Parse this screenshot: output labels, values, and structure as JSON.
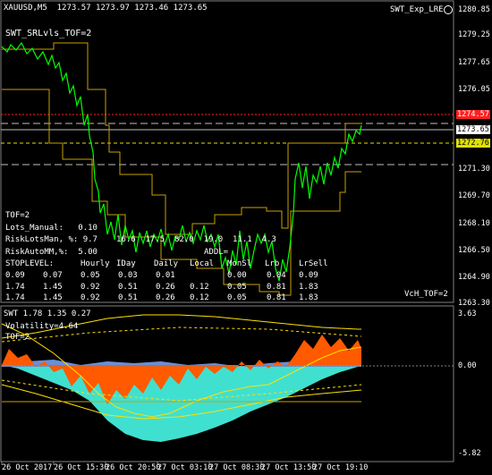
{
  "header": {
    "symbol_info": "XAUUSD,M5  1273.57 1273.97 1273.46 1273.65",
    "indicator_name": "SWT_SRLvls_TOF=2",
    "expert_name": "SWT_Exp_LRE"
  },
  "price_axis": {
    "labels": [
      "1280.85",
      "1279.25",
      "1277.65",
      "1276.05",
      "1274.57",
      "1273.65",
      "1272.76",
      "1271.30",
      "1269.70",
      "1268.10",
      "1266.50",
      "1264.90",
      "1263.30"
    ],
    "bid_tag": {
      "text": "1274.57",
      "color": "#ff3030"
    },
    "current_tag": {
      "text": "1273.65",
      "color": "#ffffff"
    },
    "level_tag": {
      "text": "1272.76",
      "color": "#e0e000"
    }
  },
  "info_panel": {
    "line_tof": "TOF=2",
    "line_lots": "Lots_Manual:   0.10",
    "line_risk_lots": "RiskLotsMan, %: 9.7",
    "line_risk_auto": "RiskAutoMM,%:  5.00",
    "line_stoplevel": "STOPLEVEL:",
    "col_headers": [
      "Hourly",
      "IDay",
      "Daily",
      "Local",
      "MonSl",
      "Lrb",
      "LrSell"
    ],
    "rows": [
      [
        "0.09",
        "0.07",
        "0.05",
        "0.03",
        "0.01",
        "0.00",
        "0.04",
        "0.09"
      ],
      [
        "1.74",
        "1.45",
        "0.92",
        "0.51",
        "0.26",
        "0.12",
        "0.05",
        "0.81",
        "1.83"
      ],
      [
        "1.74",
        "1.45",
        "0.92",
        "0.51",
        "0.26",
        "0.12",
        "0.05",
        "0.81",
        "1.83"
      ]
    ],
    "overlay_row": "16.6  17.5  82.0  19.0  11.1  4.3",
    "overlay_row2": "ADDL="
  },
  "vch_label": "VcH_TOF=2",
  "osc": {
    "title": "SWT 1.78 1.35 0.27",
    "volatility": "Volatility=4.64",
    "tof": "TOF=2",
    "axis_labels": [
      "3.63",
      "0.00",
      "-5.82"
    ]
  },
  "time_axis": {
    "labels": [
      "26 Oct 2017",
      "26 Oct 15:30",
      "26 Oct 20:50",
      "27 Oct 03:10",
      "27 Oct 08:30",
      "27 Oct 13:50",
      "27 Oct 19:10"
    ]
  },
  "colors": {
    "price": "#00ff00",
    "level": "#e0c000",
    "bid_line": "#ff2020",
    "osc_cyan": "#40e0d0",
    "osc_orange": "#ff5a00",
    "osc_blue": "#6a8fd8",
    "osc_yellow": "#ffe000"
  }
}
